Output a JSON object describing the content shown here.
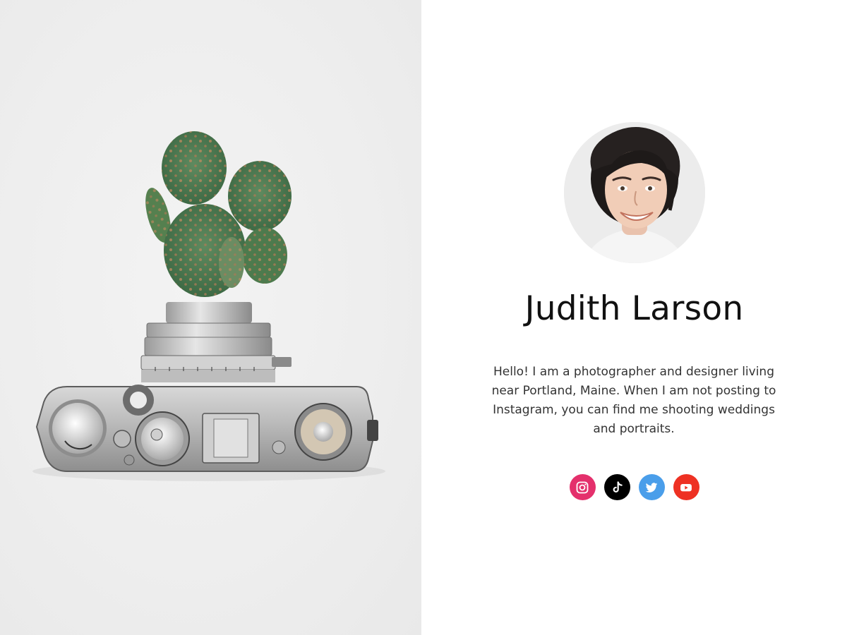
{
  "profile": {
    "name": "Judith Larson",
    "bio": "Hello! I am a photographer and designer living near Portland, Maine. When I am not posting to Instagram, you can find me shooting weddings and portraits."
  },
  "hero_image": {
    "subject": "vintage-camera-with-cactus"
  },
  "avatar_image": {
    "subject": "portrait-photo"
  },
  "social": [
    {
      "network": "Instagram",
      "icon": "instagram-icon",
      "color": "#e4306c"
    },
    {
      "network": "TikTok",
      "icon": "tiktok-icon",
      "color": "#000000"
    },
    {
      "network": "Twitter",
      "icon": "twitter-icon",
      "color": "#4a9eea"
    },
    {
      "network": "YouTube",
      "icon": "youtube-icon",
      "color": "#ee3123"
    }
  ]
}
